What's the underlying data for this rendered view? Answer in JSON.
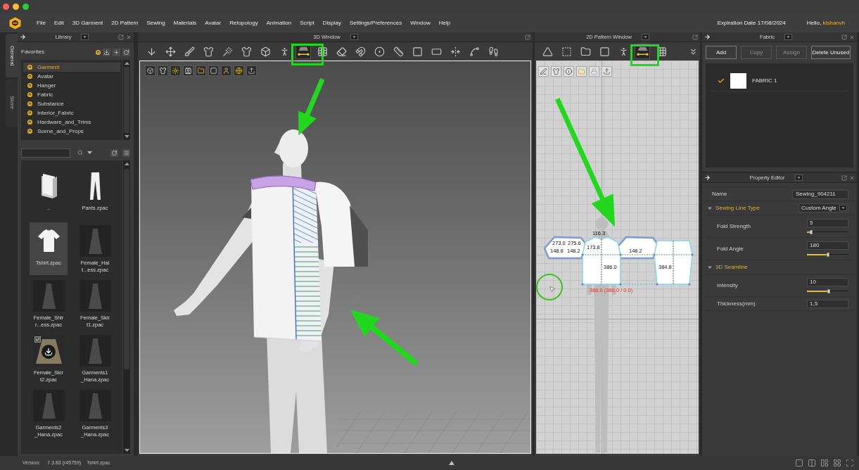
{
  "menu_bar": {
    "items": [
      "File",
      "Edit",
      "3D Garment",
      "2D Pattern",
      "Sewing",
      "Materials",
      "Avatar",
      "Retopology",
      "Animation",
      "Script",
      "Display",
      "Settings/Preferences",
      "Window",
      "Help"
    ],
    "expiration": "Expiration Date 17/08/2024",
    "greeting": "Hello,",
    "user": "kishanvh"
  },
  "side_tabs": [
    {
      "label": "General",
      "selected": true
    },
    {
      "label": "Store",
      "selected": false
    }
  ],
  "library": {
    "title": "Library",
    "favorites_label": "Favorites",
    "favorites": [
      {
        "label": "Garment",
        "selected": true
      },
      {
        "label": "Avatar",
        "selected": false
      },
      {
        "label": "Hanger",
        "selected": false
      },
      {
        "label": "Fabric",
        "selected": false
      },
      {
        "label": "Substance",
        "selected": false
      },
      {
        "label": "Interior_Fabric",
        "selected": false
      },
      {
        "label": "Hardware_and_Trims",
        "selected": false
      },
      {
        "label": "Scene_and_Props",
        "selected": false
      }
    ],
    "files": [
      {
        "name_lines": [
          ".."
        ],
        "kind": "folder",
        "selected": false
      },
      {
        "name_lines": [
          "Pants.zpac"
        ],
        "kind": "pants",
        "selected": false
      },
      {
        "name_lines": [
          "Tshirt.zpac"
        ],
        "kind": "tshirt",
        "selected": true
      },
      {
        "name_lines": [
          "Female_Hal",
          "t...ess.zpac"
        ],
        "kind": "outfit",
        "selected": false
      },
      {
        "name_lines": [
          "Female_Shir",
          "r...ess.zpac"
        ],
        "kind": "outfit",
        "selected": false
      },
      {
        "name_lines": [
          "Female_Skir",
          "t1.zpac"
        ],
        "kind": "outfit",
        "selected": false
      },
      {
        "name_lines": [
          "Female_Skir",
          "t2.zpac"
        ],
        "kind": "skirt",
        "selected": false,
        "checked": true,
        "downloadable": true
      },
      {
        "name_lines": [
          "Garments1",
          "_Hana.zpac"
        ],
        "kind": "outfit",
        "selected": false
      },
      {
        "name_lines": [
          "Garments2",
          "_Hana.zpac"
        ],
        "kind": "outfit",
        "selected": false
      },
      {
        "name_lines": [
          "Garments3",
          "_Hana.zpac"
        ],
        "kind": "outfit",
        "selected": false
      }
    ]
  },
  "window_3d": {
    "title": "3D Window",
    "tools": [
      {
        "selected": false
      },
      {
        "selected": false
      },
      {
        "selected": false
      },
      {
        "selected": false
      },
      {
        "selected": false
      },
      {
        "selected": false
      },
      {
        "selected": false
      },
      {
        "selected": false
      },
      {
        "selected": true
      },
      {
        "selected": false
      },
      {
        "selected": false
      },
      {
        "selected": false
      },
      {
        "selected": false
      },
      {
        "selected": false
      },
      {
        "selected": false
      },
      {
        "selected": false
      },
      {
        "selected": false
      },
      {
        "selected": false
      },
      {
        "selected": false
      }
    ]
  },
  "window_2d": {
    "title": "2D Pattern Window",
    "tools": [
      {
        "selected": false
      },
      {
        "selected": false
      },
      {
        "selected": false
      },
      {
        "selected": false
      },
      {
        "selected": false
      },
      {
        "selected": true
      },
      {
        "selected": false
      }
    ],
    "measurements": [
      "273.0",
      "275.6",
      "148.8",
      "148.2",
      "116.3",
      "173.8",
      "386.0",
      "148.2",
      "384.8"
    ],
    "length_reading": "386.0 (386.0 / 0.0)"
  },
  "fabric_panel": {
    "title": "Fabric",
    "buttons": [
      {
        "label": "Add",
        "disabled": false
      },
      {
        "label": "Copy",
        "disabled": true
      },
      {
        "label": "Assign",
        "disabled": true
      },
      {
        "label": "Delete Unused",
        "disabled": false
      }
    ],
    "fabrics": [
      {
        "name": "FABRIC 1",
        "checked": true,
        "color": "#ffffff"
      }
    ]
  },
  "property_editor": {
    "title": "Property Editor",
    "name": {
      "label": "Name",
      "value": "Sewing_904211"
    },
    "sections": [
      {
        "label": "Sewing Line Type",
        "expanded": true,
        "dropdown": "Custom Angle",
        "rows": [
          {
            "label": "Fold Strength",
            "kind": "slider",
            "value": "5",
            "level": 0.1
          },
          {
            "label": "Fold Angle",
            "kind": "slider",
            "value": "180",
            "level": 0.5
          }
        ]
      },
      {
        "label": "3D Seamline",
        "expanded": true,
        "rows": [
          {
            "label": "Intensity",
            "kind": "slider",
            "value": "10",
            "level": 0.53
          },
          {
            "label": "Thickness(mm)",
            "kind": "field",
            "value": "1,5"
          }
        ]
      }
    ]
  },
  "status_bar": {
    "version_label": "Version:",
    "version": "7.3.83 (r45759)",
    "file": "Tshirt.zpac"
  }
}
